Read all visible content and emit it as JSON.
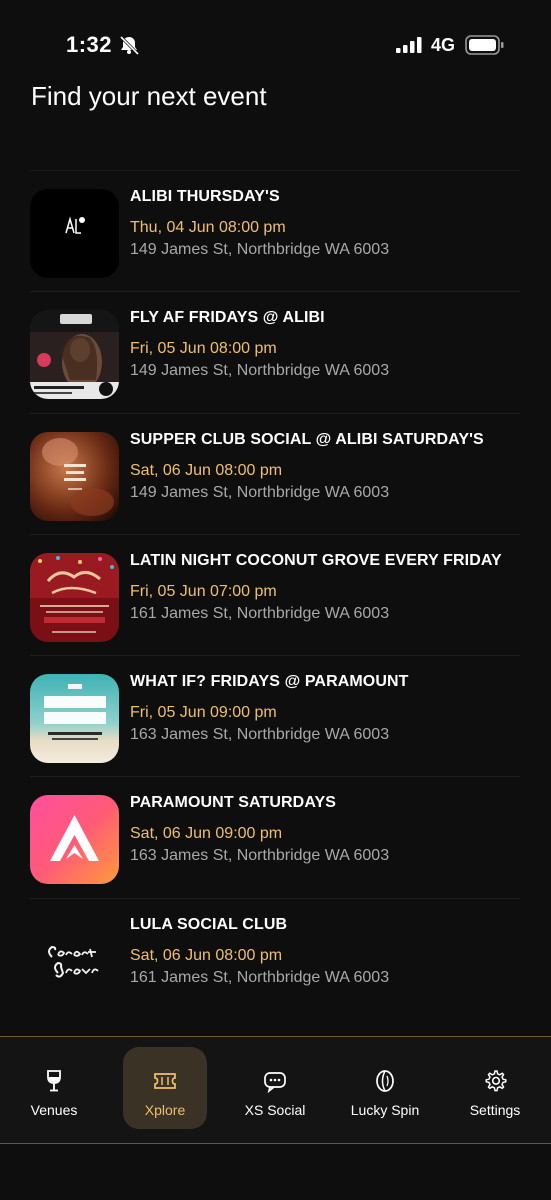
{
  "status_bar": {
    "time": "1:32",
    "network": "4G"
  },
  "page_title": "Find your next event",
  "events": [
    {
      "title": "ALIBI THURSDAY'S",
      "date": "Thu, 04 Jun 08:00 pm",
      "address": "149 James St, Northbridge WA 6003",
      "thumb": "alibi-logo"
    },
    {
      "title": "FLY AF FRIDAYS @ ALIBI",
      "date": "Fri, 05 Jun 08:00 pm",
      "address": "149 James St, Northbridge WA 6003",
      "thumb": "fly-af-poster"
    },
    {
      "title": "SUPPER CLUB SOCIAL @ ALIBI SATURDAY'S",
      "date": "Sat, 06 Jun 08:00 pm",
      "address": "149 James St, Northbridge WA 6003",
      "thumb": "supper-club-poster"
    },
    {
      "title": "LATIN NIGHT COCONUT GROVE EVERY FRIDAY",
      "date": "Fri, 05 Jun 07:00 pm",
      "address": "161 James St, Northbridge WA 6003",
      "thumb": "latin-night-poster"
    },
    {
      "title": "WHAT IF? FRIDAYS @ PARAMOUNT",
      "date": "Fri, 05 Jun 09:00 pm",
      "address": "163 James St, Northbridge WA 6003",
      "thumb": "summer-series-poster"
    },
    {
      "title": "PARAMOUNT SATURDAYS",
      "date": "Sat, 06 Jun 09:00 pm",
      "address": "163 James St, Northbridge WA 6003",
      "thumb": "paramount-logo"
    },
    {
      "title": "LULA SOCIAL CLUB",
      "date": "Sat, 06 Jun 08:00 pm",
      "address": "161 James St, Northbridge WA 6003",
      "thumb": "coconut-grove-logo"
    }
  ],
  "nav": {
    "items": [
      {
        "label": "Venues",
        "icon": "wine-glass-icon"
      },
      {
        "label": "Xplore",
        "icon": "ticket-icon"
      },
      {
        "label": "XS Social",
        "icon": "chat-bubble-icon"
      },
      {
        "label": "Lucky Spin",
        "icon": "coin-icon"
      },
      {
        "label": "Settings",
        "icon": "gear-icon"
      }
    ],
    "active": "Xplore"
  },
  "colors": {
    "accent": "#f0bf6e",
    "background": "#0e0e0e",
    "muted_text": "#a8a8a8",
    "active_tab_bg": "#3a3225"
  }
}
